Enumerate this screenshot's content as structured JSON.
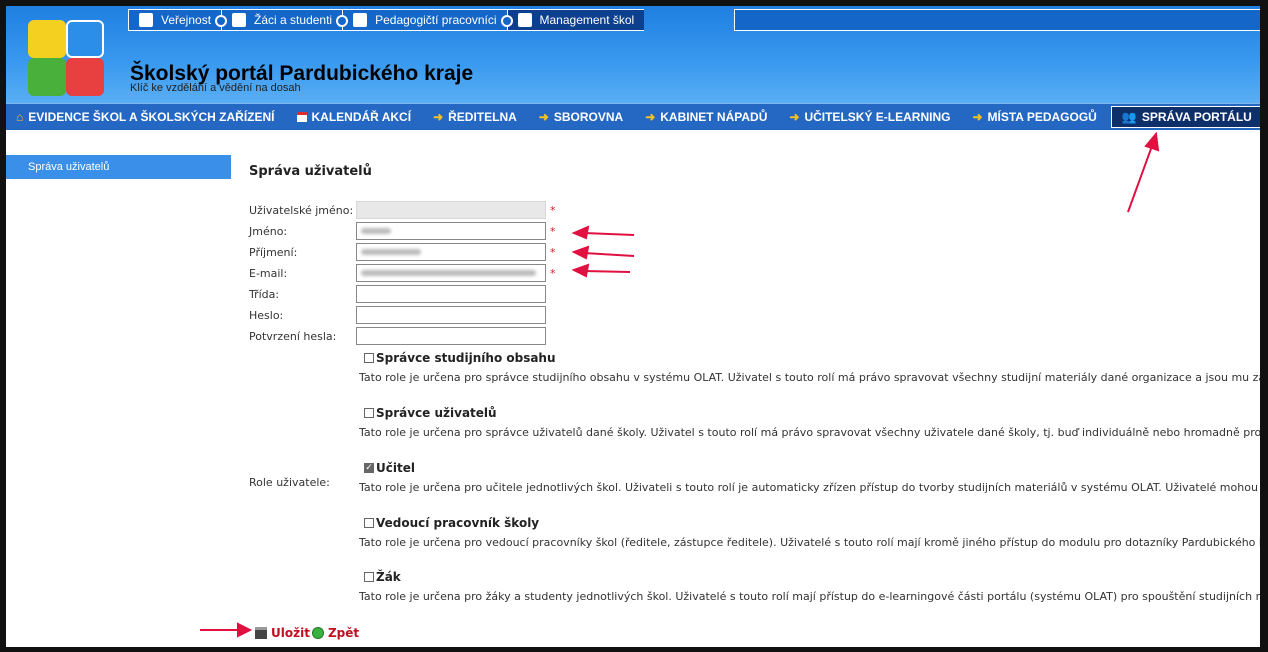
{
  "top_nav": [
    {
      "label": "Veřejnost",
      "icon": "public-people-icon"
    },
    {
      "label": "Žáci a studenti",
      "icon": "students-icon"
    },
    {
      "label": "Pedagogičtí pracovníci",
      "icon": "teacher-icon"
    },
    {
      "label": "Management škol",
      "icon": "management-icon"
    }
  ],
  "site": {
    "title": "Školský portál Pardubického kraje",
    "subtitle": "Klíč ke vzdělání a vědění na dosah"
  },
  "main_menu": [
    {
      "label": "EVIDENCE ŠKOL A ŠKOLSKÝCH ZAŘÍZENÍ",
      "icon": "house-icon"
    },
    {
      "label": "KALENDÁŘ AKCÍ",
      "icon": "calendar-icon"
    },
    {
      "label": "ŘEDITELNA",
      "icon": "arrow-right-icon"
    },
    {
      "label": "SBOROVNA",
      "icon": "arrow-right-icon"
    },
    {
      "label": "KABINET NÁPADŮ",
      "icon": "arrow-right-icon"
    },
    {
      "label": "UČITELSKÝ E-LEARNING",
      "icon": "arrow-right-icon"
    },
    {
      "label": "MÍSTA PEDAGOGŮ",
      "icon": "arrow-right-icon"
    },
    {
      "label": "SPRÁVA PORTÁLU",
      "icon": "users-icon"
    }
  ],
  "sidebar": {
    "items": [
      {
        "label": "Správa uživatelů"
      }
    ]
  },
  "form": {
    "title": "Správa uživatelů",
    "username_label": "Uživatelské jméno:",
    "firstname_label": "Jméno:",
    "lastname_label": "Příjmení:",
    "email_label": "E-mail:",
    "class_label": "Třída:",
    "password_label": "Heslo:",
    "password_confirm_label": "Potvrzení hesla:",
    "required_mark": "*",
    "roles_label": "Role uživatele:"
  },
  "roles": [
    {
      "title": "Správce studijního obsahu",
      "checked": false,
      "desc": "Tato role je určena pro správce studijního obsahu v systému OLAT. Uživatel s touto rolí má právo spravovat všechny studijní materiály dané organizace a jsou mu zasí"
    },
    {
      "title": "Správce uživatelů",
      "checked": false,
      "desc": "Tato role je určena pro správce uživatelů dané školy. Uživatel s touto rolí má právo spravovat všechny uživatele dané školy, tj. buď individuálně nebo hromadně provát"
    },
    {
      "title": "Učitel",
      "checked": true,
      "desc": "Tato role je určena pro učitele jednotlivých škol. Uživateli s touto rolí je automaticky zřízen přístup do tvorby studijních materiálů v systému OLAT. Uživatelé mohou vk"
    },
    {
      "title": "Vedoucí pracovník školy",
      "checked": false,
      "desc": "Tato role je určena pro vedoucí pracovníky škol (ředitele, zástupce ředitele). Uživatelé s touto rolí mají kromě jiného přístup do modulu pro dotazníky Pardubického kr"
    },
    {
      "title": "Žák",
      "checked": false,
      "desc": "Tato role je určena pro žáky a studenty jednotlivých škol. Uživatelé s touto rolí mají přístup do e-learningové části portálu (systému OLAT) pro spouštění studijních ma"
    }
  ],
  "actions": {
    "save_label": "Uložit",
    "back_label": "Zpět"
  },
  "colors": {
    "header_blue": "#2b8ee8",
    "menu_blue": "#2468c4",
    "active_menu": "#0d2f6a",
    "annotation_red": "#e01040",
    "link_red": "#c01020"
  }
}
